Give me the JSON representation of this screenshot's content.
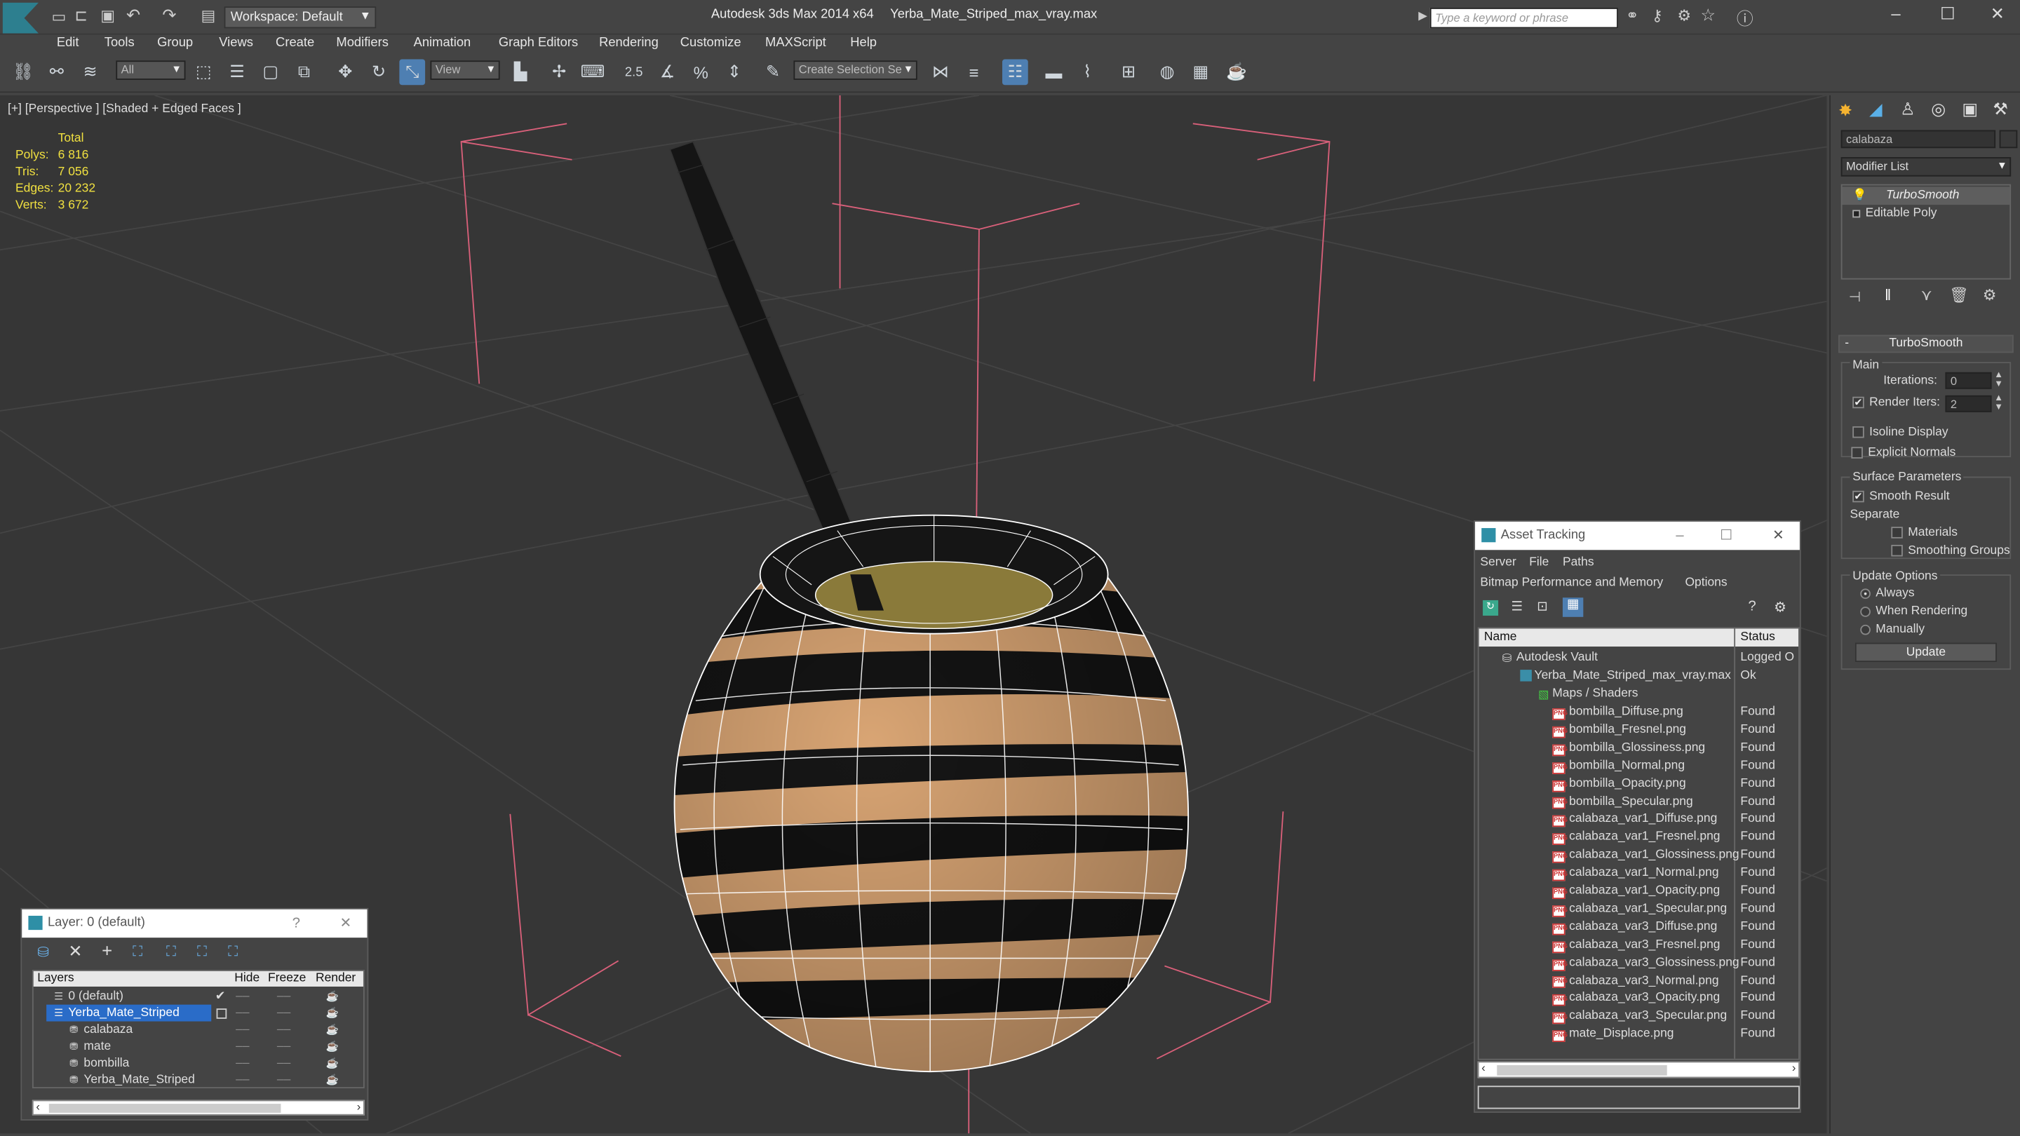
{
  "app": {
    "title": "Autodesk 3ds Max 2014 x64",
    "file": "Yerba_Mate_Striped_max_vray.max",
    "workspace": "Workspace: Default",
    "search_placeholder": "Type a keyword or phrase"
  },
  "menu": [
    "Edit",
    "Tools",
    "Group",
    "Views",
    "Create",
    "Modifiers",
    "Animation",
    "Graph Editors",
    "Rendering",
    "Customize",
    "MAXScript",
    "Help"
  ],
  "toolbar": {
    "filter": "All",
    "ref_coord": "View",
    "snap_label": "2.5",
    "selection_set_placeholder": "Create Selection Se"
  },
  "viewport": {
    "label": "[+] [Perspective ] [Shaded + Edged Faces ]",
    "stats": {
      "header": "Total",
      "rows": [
        {
          "label": "Polys:",
          "value": "6 816"
        },
        {
          "label": "Tris:",
          "value": "7 056"
        },
        {
          "label": "Edges:",
          "value": "20 232"
        },
        {
          "label": "Verts:",
          "value": "3 672"
        }
      ]
    }
  },
  "command_panel": {
    "object_name": "calabaza",
    "modifier_list": "Modifier List",
    "stack": [
      "TurboSmooth",
      "Editable Poly"
    ],
    "rollout_title": "TurboSmooth",
    "main_label": "Main",
    "iterations_label": "Iterations:",
    "iterations_value": "0",
    "render_iters_label": "Render Iters:",
    "render_iters_value": "2",
    "isoline": "Isoline Display",
    "explicit_normals": "Explicit Normals",
    "surface_params": "Surface Parameters",
    "smooth_result": "Smooth Result",
    "separate": "Separate",
    "materials": "Materials",
    "smoothing_groups": "Smoothing Groups",
    "update_options": "Update Options",
    "always": "Always",
    "when_rendering": "When Rendering",
    "manually": "Manually",
    "update_button": "Update"
  },
  "asset_tracking": {
    "title": "Asset Tracking",
    "menu1": [
      "Server",
      "File",
      "Paths"
    ],
    "menu2": [
      "Bitmap Performance and Memory",
      "Options"
    ],
    "col_name": "Name",
    "col_status": "Status",
    "vault": {
      "name": "Autodesk Vault",
      "status": "Logged O"
    },
    "file": {
      "name": "Yerba_Mate_Striped_max_vray.max",
      "status": "Ok"
    },
    "maps_group": "Maps / Shaders",
    "maps": [
      {
        "name": "bombilla_Diffuse.png",
        "status": "Found"
      },
      {
        "name": "bombilla_Fresnel.png",
        "status": "Found"
      },
      {
        "name": "bombilla_Glossiness.png",
        "status": "Found"
      },
      {
        "name": "bombilla_Normal.png",
        "status": "Found"
      },
      {
        "name": "bombilla_Opacity.png",
        "status": "Found"
      },
      {
        "name": "bombilla_Specular.png",
        "status": "Found"
      },
      {
        "name": "calabaza_var1_Diffuse.png",
        "status": "Found"
      },
      {
        "name": "calabaza_var1_Fresnel.png",
        "status": "Found"
      },
      {
        "name": "calabaza_var1_Glossiness.png",
        "status": "Found"
      },
      {
        "name": "calabaza_var1_Normal.png",
        "status": "Found"
      },
      {
        "name": "calabaza_var1_Opacity.png",
        "status": "Found"
      },
      {
        "name": "calabaza_var1_Specular.png",
        "status": "Found"
      },
      {
        "name": "calabaza_var3_Diffuse.png",
        "status": "Found"
      },
      {
        "name": "calabaza_var3_Fresnel.png",
        "status": "Found"
      },
      {
        "name": "calabaza_var3_Glossiness.png",
        "status": "Found"
      },
      {
        "name": "calabaza_var3_Normal.png",
        "status": "Found"
      },
      {
        "name": "calabaza_var3_Opacity.png",
        "status": "Found"
      },
      {
        "name": "calabaza_var3_Specular.png",
        "status": "Found"
      },
      {
        "name": "mate_Displace.png",
        "status": "Found"
      }
    ]
  },
  "layer_panel": {
    "title": "Layer: 0 (default)",
    "help": "?",
    "col_layers": "Layers",
    "col_hide": "Hide",
    "col_freeze": "Freeze",
    "col_render": "Render",
    "rows": [
      {
        "name": "0 (default)",
        "level": 1
      },
      {
        "name": "Yerba_Mate_Striped",
        "level": 1,
        "selected": true
      },
      {
        "name": "calabaza",
        "level": 2
      },
      {
        "name": "mate",
        "level": 2
      },
      {
        "name": "bombilla",
        "level": 2
      },
      {
        "name": "Yerba_Mate_Striped",
        "level": 2
      }
    ]
  },
  "colors": {
    "selection": "#2a6cc8",
    "gizmo": "#d9607a",
    "wire": "#ffffff",
    "gourd_light": "#e0ad7c",
    "gourd_dark": "#121212"
  }
}
